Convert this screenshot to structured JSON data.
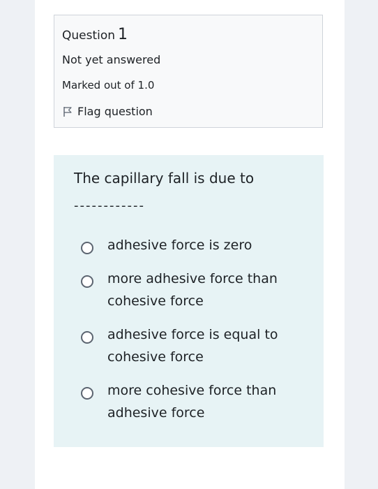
{
  "question_info": {
    "title_prefix": "Question",
    "number": "1",
    "state": "Not yet answered",
    "grade": "Marked out of 1.0",
    "flag_label": "Flag question"
  },
  "question": {
    "text": "The capillary fall  is due to",
    "blank": "------------",
    "options": [
      {
        "label": "adhesive force is zero"
      },
      {
        "label": "more adhesive force than cohesive force"
      },
      {
        "label": "adhesive force is equal to cohesive force"
      },
      {
        "label": "more cohesive force than adhesive force"
      }
    ]
  },
  "colors": {
    "content_bg": "#e7f3f5",
    "info_bg": "#f8f9fa",
    "border": "#cfd4da"
  }
}
